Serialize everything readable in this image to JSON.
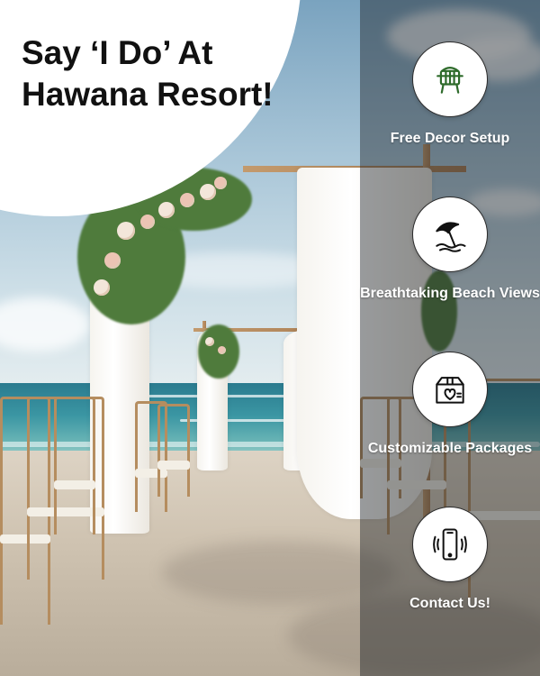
{
  "headline": "Say ‘I Do’ At Hawana Resort!",
  "colors": {
    "headline_text": "#111111",
    "bubble": "#ffffff",
    "feature_label": "#ffffff",
    "icon_ring": "#2b2b2b",
    "panel_overlay": "rgba(30, 36, 40, 0.45)"
  },
  "background_image": "beach wedding ceremony with draped wooden arches and chairs",
  "features": [
    {
      "icon": "decor-icon",
      "label": "Free Decor Setup"
    },
    {
      "icon": "beach-umbrella-icon",
      "label": "Breathtaking Beach Views"
    },
    {
      "icon": "gift-box-heart-icon",
      "label": "Customizable Packages"
    },
    {
      "icon": "phone-icon",
      "label": "Contact Us!"
    }
  ]
}
